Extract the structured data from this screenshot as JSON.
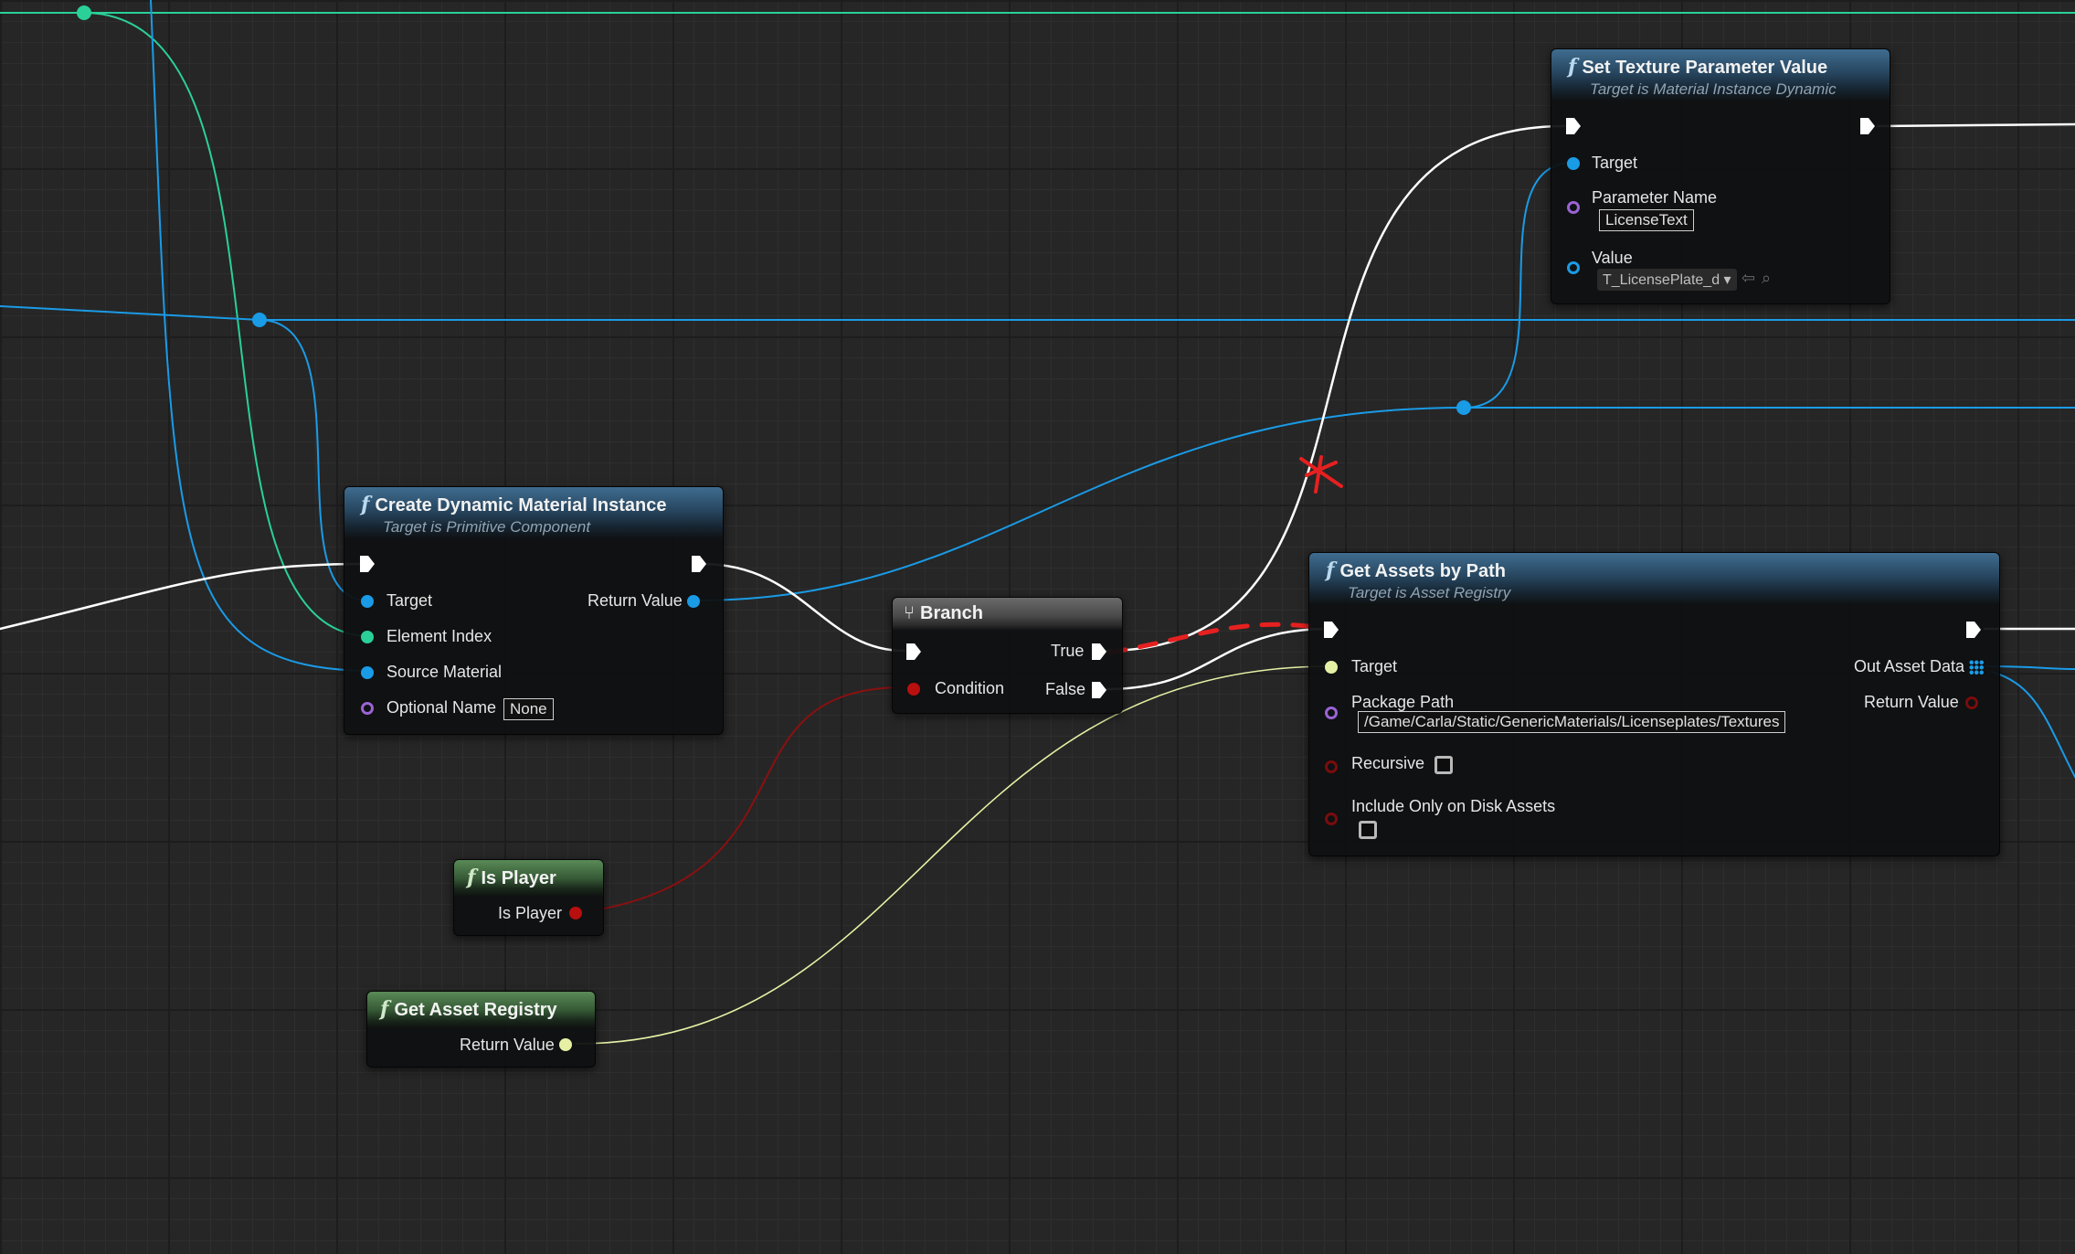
{
  "colors": {
    "exec_wire": "#ffffff",
    "object_wire": "#1a9be6",
    "int_wire": "#2ad098",
    "bool_wire": "#8a1010",
    "registry_wire": "#e6f0a4",
    "annotation": "#e62020"
  },
  "nodes": {
    "set_texture": {
      "title": "Set Texture Parameter Value",
      "subtitle": "Target is Material Instance Dynamic",
      "pin_target": "Target",
      "pin_param_name": "Parameter Name",
      "param_name_value": "LicenseText",
      "pin_value": "Value",
      "value_asset": "T_LicensePlate_d"
    },
    "create_dmi": {
      "title": "Create Dynamic Material Instance",
      "subtitle": "Target is Primitive Component",
      "pin_target": "Target",
      "pin_element_index": "Element Index",
      "pin_source_material": "Source Material",
      "pin_optional_name": "Optional Name",
      "optional_name_value": "None",
      "pin_return_value": "Return Value"
    },
    "branch": {
      "title": "Branch",
      "pin_condition": "Condition",
      "pin_true": "True",
      "pin_false": "False"
    },
    "get_assets": {
      "title": "Get Assets by Path",
      "subtitle": "Target is Asset Registry",
      "pin_target": "Target",
      "pin_package_path": "Package Path",
      "package_path_value": "/Game/Carla/Static/GenericMaterials/Licenseplates/Textures",
      "pin_recursive": "Recursive",
      "pin_include_disk": "Include Only on Disk Assets",
      "pin_out_asset_data": "Out Asset Data",
      "pin_return_value": "Return Value"
    },
    "is_player": {
      "title": "Is Player",
      "pin_out": "Is Player"
    },
    "get_registry": {
      "title": "Get Asset Registry",
      "pin_return_value": "Return Value"
    }
  },
  "icons": {
    "function": "f",
    "branch": "branch-icon",
    "back_arrow": "arrow-left-icon",
    "browse": "magnifier-icon",
    "array_out": "grid-icon"
  }
}
